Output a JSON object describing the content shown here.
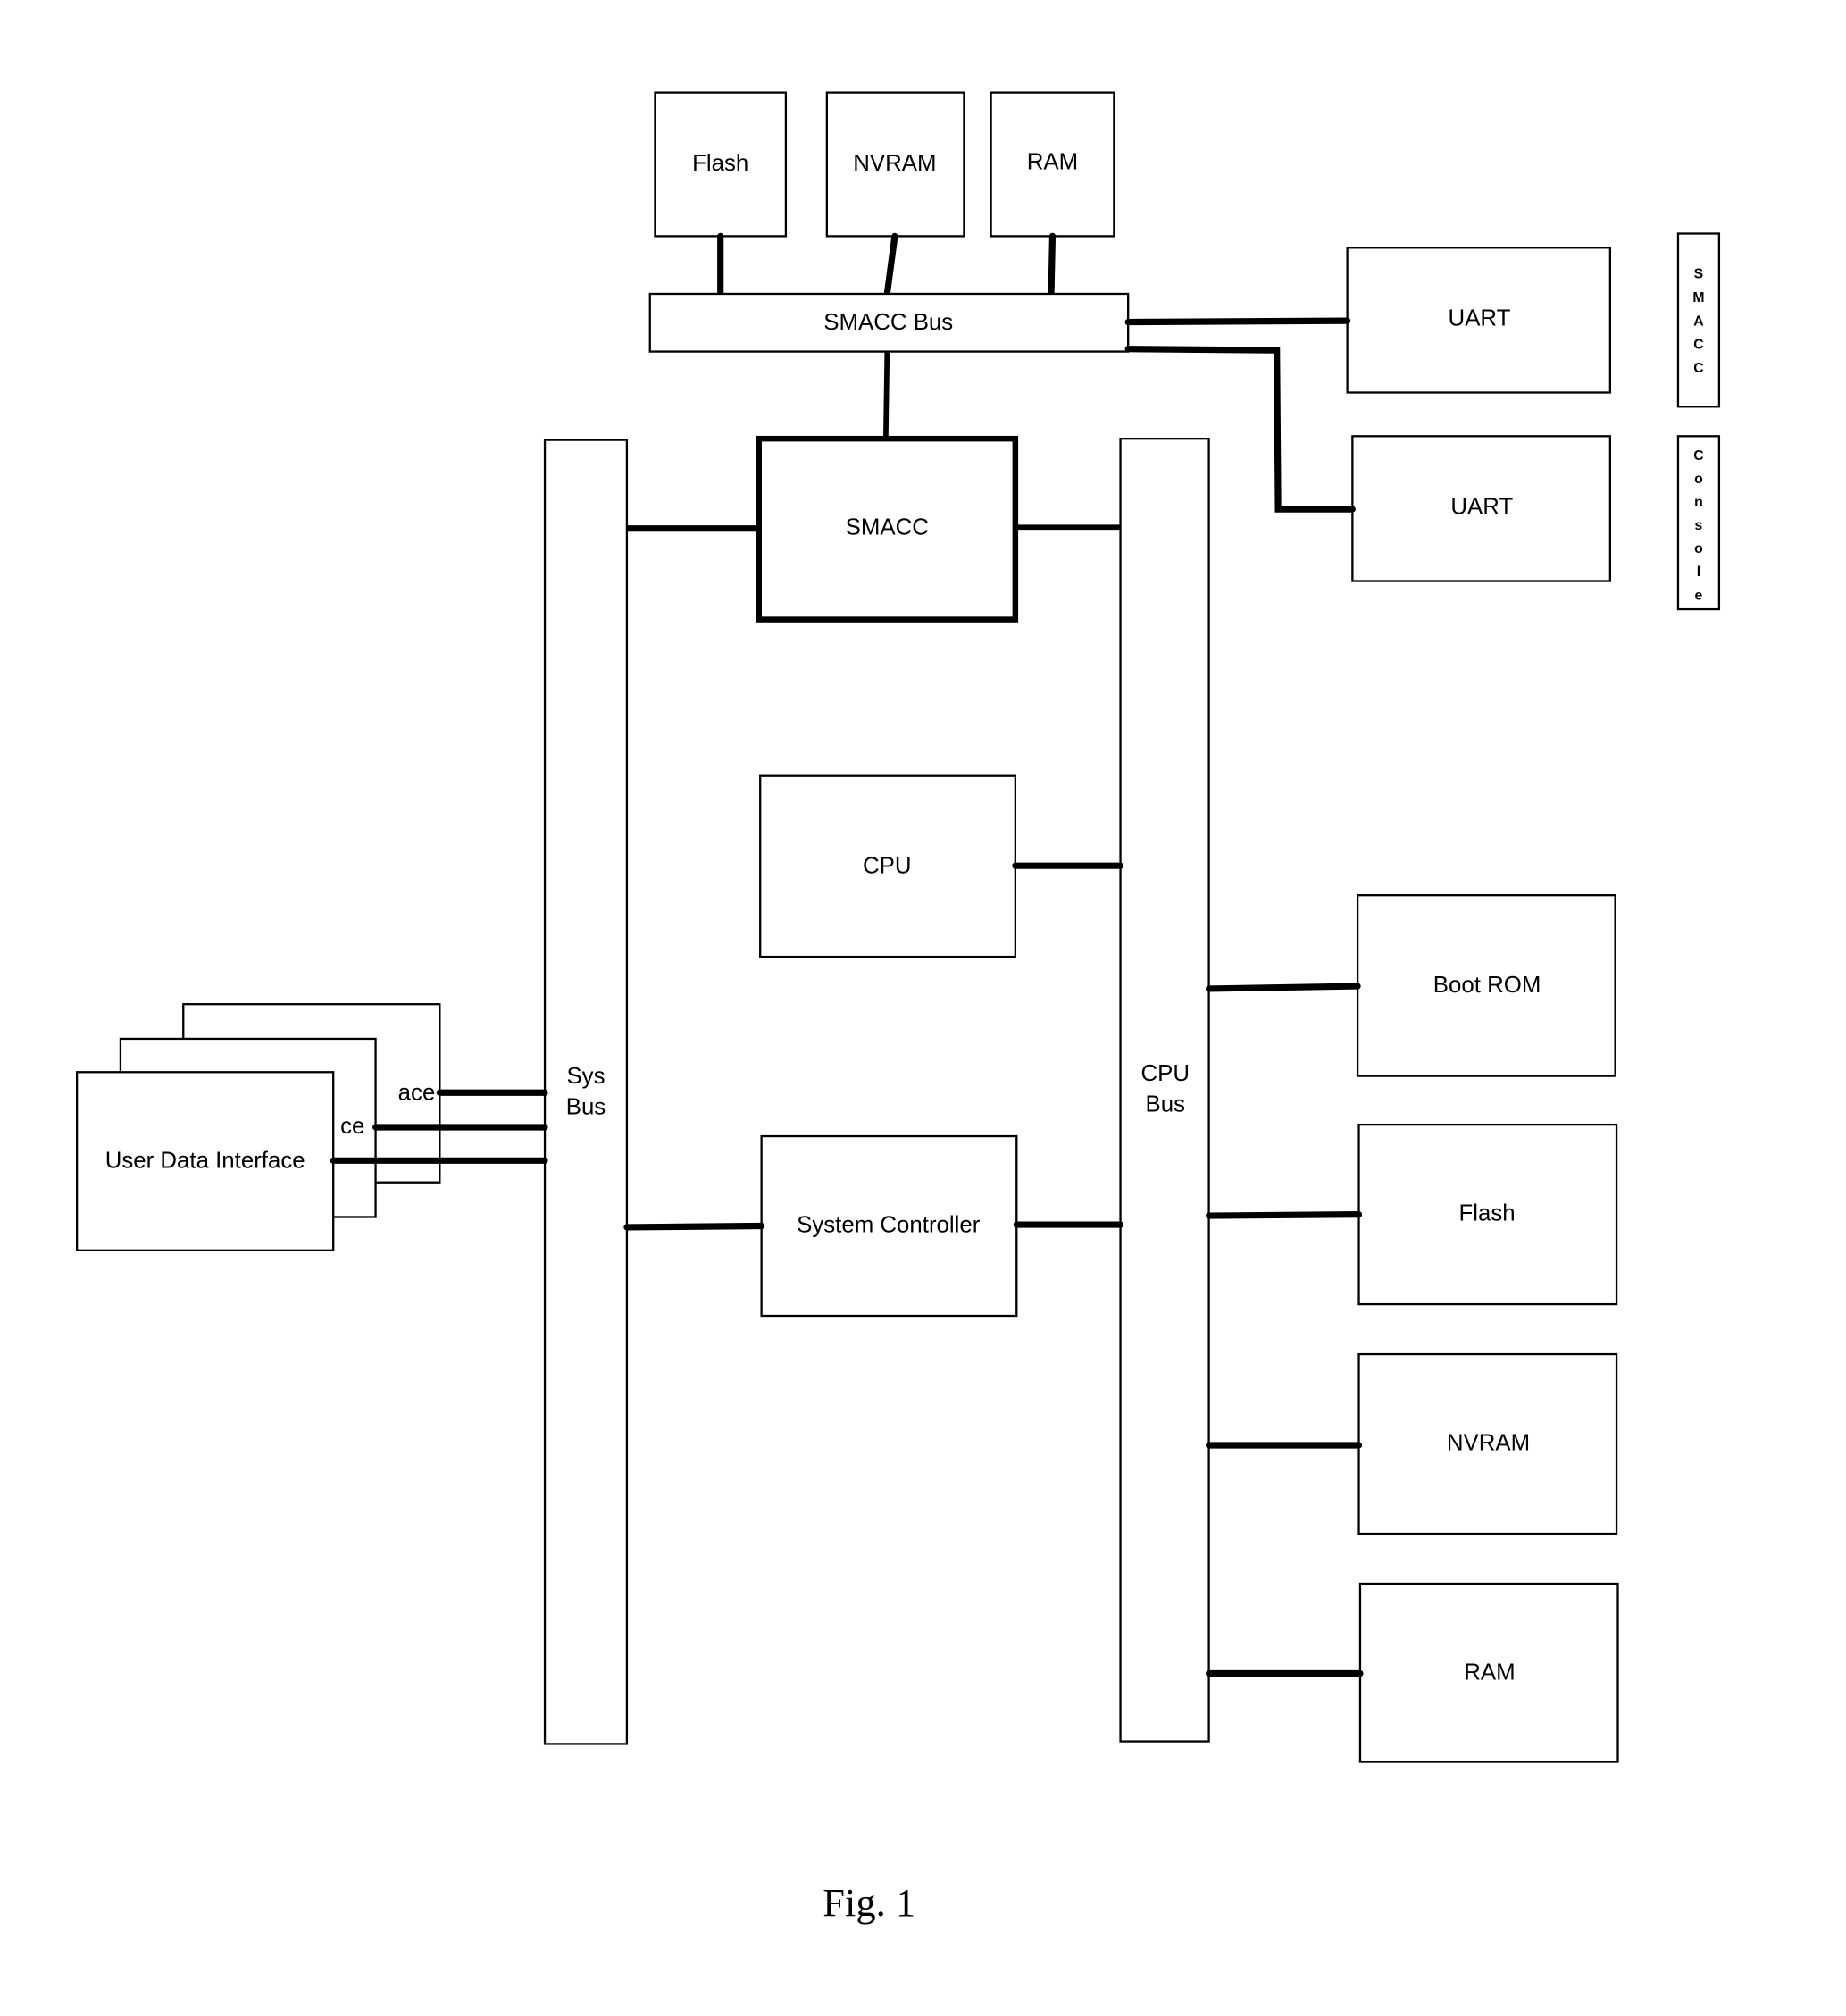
{
  "figure": {
    "caption": "Fig. 1",
    "smacc_bus_group": {
      "memories": [
        {
          "id": "smacc-flash",
          "label": "Flash"
        },
        {
          "id": "smacc-nvram",
          "label": "NVRAM"
        },
        {
          "id": "smacc-ram",
          "label": "RAM"
        }
      ],
      "bus_label": "SMACC Bus"
    },
    "uarts": [
      {
        "id": "uart-smacc",
        "label": "UART",
        "port_label": "SMACC"
      },
      {
        "id": "uart-console",
        "label": "UART",
        "port_label": "Console"
      }
    ],
    "core": {
      "smacc": "SMACC",
      "cpu": "CPU",
      "system_controller": "System Controller"
    },
    "buses": {
      "sys_bus": [
        "Sys",
        "Bus"
      ],
      "cpu_bus": [
        "CPU",
        "Bus"
      ]
    },
    "cpu_bus_devices": [
      {
        "id": "boot-rom",
        "label": "Boot ROM"
      },
      {
        "id": "cpu-flash",
        "label": "Flash"
      },
      {
        "id": "cpu-nvram",
        "label": "NVRAM"
      },
      {
        "id": "cpu-ram",
        "label": "RAM"
      }
    ],
    "user_data_interfaces": {
      "label": "User Data Interface",
      "back_fragment": "face",
      "middle_fragment": "ce",
      "count": 3
    }
  }
}
